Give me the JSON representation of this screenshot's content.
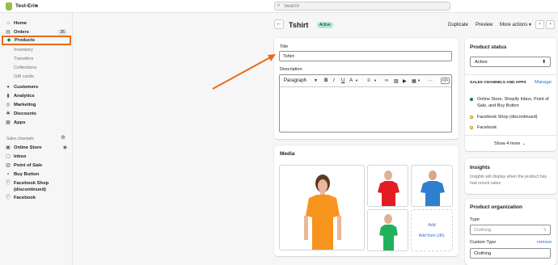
{
  "topbar": {
    "store_name": "Test-Erin",
    "search_placeholder": "Search"
  },
  "sidebar": {
    "items": [
      {
        "label": "Home",
        "icon": "home-icon"
      },
      {
        "label": "Orders",
        "icon": "orders-icon",
        "badge": "26"
      },
      {
        "label": "Products",
        "icon": "tag-icon",
        "selected": true
      },
      {
        "label": "Inventory",
        "sub": true
      },
      {
        "label": "Transfers",
        "sub": true
      },
      {
        "label": "Collections",
        "sub": true
      },
      {
        "label": "Gift cards",
        "sub": true
      },
      {
        "label": "Customers",
        "icon": "person-icon"
      },
      {
        "label": "Analytics",
        "icon": "chart-icon"
      },
      {
        "label": "Marketing",
        "icon": "target-icon"
      },
      {
        "label": "Discounts",
        "icon": "discount-icon"
      },
      {
        "label": "Apps",
        "icon": "apps-icon"
      }
    ],
    "sales_channels_label": "Sales channels",
    "channels": [
      {
        "label": "Online Store",
        "icon": "store-icon"
      },
      {
        "label": "Inbox",
        "icon": "inbox-icon"
      },
      {
        "label": "Point of Sale",
        "icon": "pos-icon"
      },
      {
        "label": "Buy Button",
        "icon": "buy-icon"
      },
      {
        "label": "Facebook Shop",
        "label2": "(discontinued)",
        "icon": "facebook-icon"
      },
      {
        "label": "Facebook",
        "icon": "facebook-icon"
      }
    ]
  },
  "header": {
    "title": "Tshirt",
    "status": "Active",
    "duplicate": "Duplicate",
    "preview": "Preview",
    "more_actions": "More actions"
  },
  "product": {
    "title_label": "Title",
    "title_value": "Tshirt",
    "description_label": "Description",
    "paragraph": "Paragraph"
  },
  "media": {
    "title": "Media",
    "add_label": "Add",
    "add_from_url": "Add from URL",
    "shirt_colors": [
      "#f7941d",
      "#e31b23",
      "#2f7fcf",
      "#1fb25a"
    ]
  },
  "status_card": {
    "title": "Product status",
    "selected": "Active",
    "channels_heading": "SALES CHANNELS AND APPS",
    "manage": "Manage",
    "channels": [
      {
        "text": "Online Store, Shopify Inbox, Point of Sale, and Buy Button",
        "active": true
      },
      {
        "text": "Facebook Shop (discontinued)",
        "active": false
      },
      {
        "text": "Facebook",
        "active": false
      }
    ],
    "show_more": "Show 4 more"
  },
  "insights": {
    "title": "Insights",
    "text": "Insights will display when the product has had recent sales"
  },
  "organization": {
    "title": "Product organization",
    "type_label": "Type",
    "type_placeholder": "Clothing",
    "custom_type_label": "Custom Type",
    "remove": "remove",
    "custom_type_value": "Clothing"
  },
  "colors": {
    "accent": "#008060",
    "highlight": "#e86a1b",
    "link": "#2c6ecb"
  }
}
